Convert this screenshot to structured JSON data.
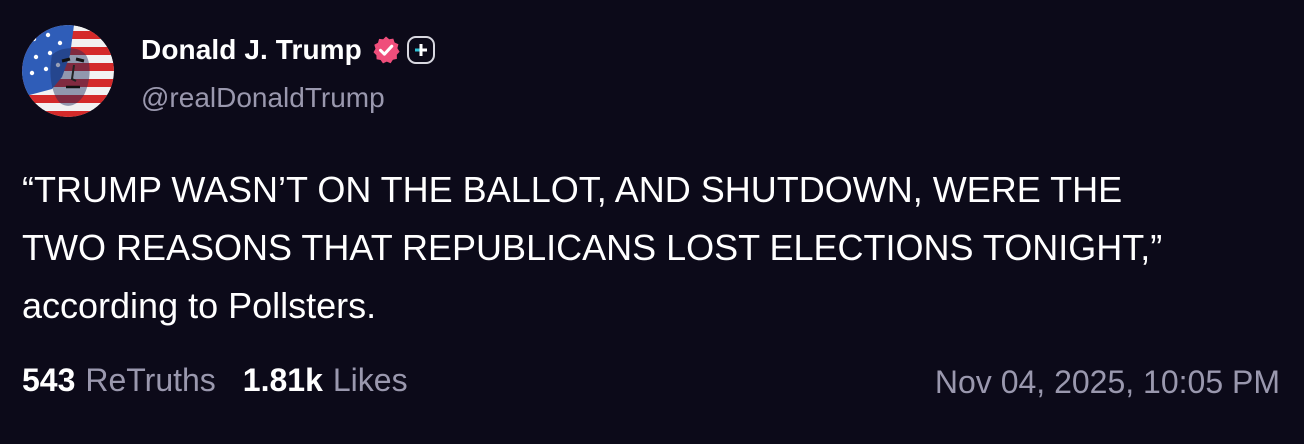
{
  "author": {
    "display_name": "Donald J. Trump",
    "handle": "@realDonaldTrump",
    "verified": true
  },
  "icons": {
    "verified": "verified-badge-icon",
    "plus": "plus-badge-icon"
  },
  "post": {
    "text": "“TRUMP WASN’T ON THE BALLOT, AND SHUTDOWN, WERE THE\nTWO REASONS THAT REPUBLICANS LOST ELECTIONS TONIGHT,”\naccording to Pollsters.",
    "timestamp": "Nov 04, 2025, 10:05 PM"
  },
  "stats": {
    "retruths_count": "543",
    "retruths_label": "ReTruths",
    "likes_count": "1.81k",
    "likes_label": "Likes"
  },
  "colors": {
    "background": "#0c0a19",
    "primary_text": "#ffffff",
    "secondary_text": "#9a98ae",
    "verified_badge": "#ef4e7b"
  }
}
